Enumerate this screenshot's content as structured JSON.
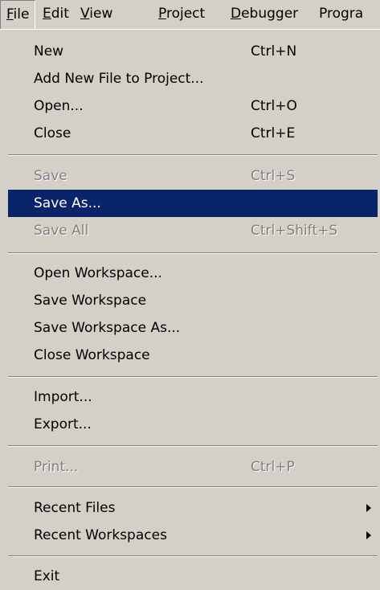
{
  "menubar": {
    "file": {
      "acc": "F",
      "rest": "ile"
    },
    "edit": {
      "acc": "E",
      "rest": "dit"
    },
    "view": {
      "acc": "V",
      "rest": "iew"
    },
    "project": {
      "acc": "P",
      "rest": "roject"
    },
    "debugger": {
      "acc": "D",
      "rest": "ebugger"
    },
    "program": {
      "text": "Progra"
    }
  },
  "menu": {
    "new": {
      "label": "New",
      "shortcut": "Ctrl+N"
    },
    "add_new_file": {
      "label": "Add New File to Project..."
    },
    "open": {
      "label": "Open...",
      "shortcut": "Ctrl+O"
    },
    "close": {
      "label": "Close",
      "shortcut": "Ctrl+E"
    },
    "save": {
      "label": "Save",
      "shortcut": "Ctrl+S",
      "enabled": false
    },
    "save_as": {
      "label": "Save As...",
      "highlighted": true
    },
    "save_all": {
      "label": "Save All",
      "shortcut": "Ctrl+Shift+S",
      "enabled": false
    },
    "open_workspace": {
      "label": "Open Workspace..."
    },
    "save_workspace": {
      "label": "Save Workspace"
    },
    "save_workspace_as": {
      "label": "Save Workspace As..."
    },
    "close_workspace": {
      "label": "Close Workspace"
    },
    "import": {
      "label": "Import..."
    },
    "export": {
      "label": "Export..."
    },
    "print": {
      "label": "Print...",
      "shortcut": "Ctrl+P",
      "enabled": false
    },
    "recent_files": {
      "label": "Recent Files",
      "submenu_icon": "submenu-arrow-icon"
    },
    "recent_workspaces": {
      "label": "Recent Workspaces",
      "submenu_icon": "submenu-arrow-icon"
    },
    "exit": {
      "label": "Exit"
    }
  },
  "colors": {
    "menu_background": "#d4d0c8",
    "highlight_background": "#0a246a",
    "highlight_text": "#ffffff",
    "disabled_text": "#808080"
  }
}
